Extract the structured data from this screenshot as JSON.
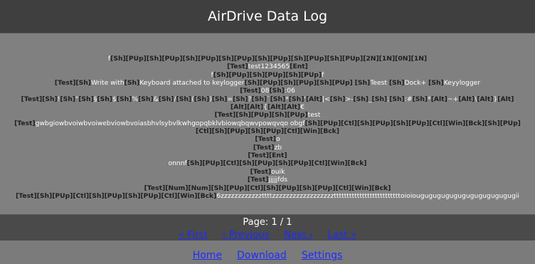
{
  "header": {
    "title": "AirDrive Data Log"
  },
  "log": {
    "lines": [
      [
        [
          "v",
          "f"
        ],
        [
          "k",
          "[Sh][PUp][Sh][PUp][Sh][PUp][Sh][PUp][Sh][PUp][Sh][PUp][Sh][PUp][2N][1N][0N][1N]"
        ]
      ],
      [
        [
          "k",
          "[Test]"
        ],
        [
          "v",
          "test1234565"
        ],
        [
          "k",
          "[Ent]"
        ]
      ],
      [
        [
          "v",
          "f"
        ],
        [
          "k",
          "[Sh][PUp][Sh][PUp][Sh][PUp]"
        ],
        [
          "v",
          "f"
        ]
      ],
      [
        [
          "k",
          "[Test][Sh]"
        ],
        [
          "v",
          "Write with"
        ],
        [
          "k",
          "[Sh]"
        ],
        [
          "v",
          "Keyboard attached to keylogger"
        ],
        [
          "k",
          "[Sh][PUp][Sh][PUp][Sh][PUp]"
        ],
        [
          "v",
          " "
        ],
        [
          "k",
          "[Sh]"
        ],
        [
          "v",
          "Teest "
        ],
        [
          "k",
          "[Sh]"
        ],
        [
          "v",
          "Dock+ "
        ],
        [
          "k",
          "[Sh]"
        ],
        [
          "v",
          "Keyylogger"
        ]
      ],
      [
        [
          "k",
          "[Test]"
        ],
        [
          "v",
          "08"
        ],
        [
          "k",
          "[Sh]"
        ],
        [
          "v",
          ":06"
        ]
      ],
      [
        [
          "k",
          "[Test][Sh]"
        ],
        [
          "v",
          "!"
        ],
        [
          "k",
          "[Sh]"
        ],
        [
          "v",
          "\""
        ],
        [
          "k",
          "[Sh]"
        ],
        [
          "v",
          "§"
        ],
        [
          "k",
          "[Sh]"
        ],
        [
          "v",
          "$"
        ],
        [
          "k",
          "[Sh]"
        ],
        [
          "v",
          "%"
        ],
        [
          "k",
          "[Sh]"
        ],
        [
          "v",
          "&"
        ],
        [
          "k",
          "[Sh]"
        ],
        [
          "v",
          "/"
        ],
        [
          "k",
          "[Sh]"
        ],
        [
          "v",
          "("
        ],
        [
          "k",
          "[Sh]"
        ],
        [
          "v",
          ")"
        ],
        [
          "k",
          "[Sh]"
        ],
        [
          "v",
          "="
        ],
        [
          "k",
          "[Sh]"
        ],
        [
          "v",
          "?"
        ],
        [
          "k",
          "[Sh]"
        ],
        [
          "v",
          "`"
        ],
        [
          "k",
          "[Sh]"
        ],
        [
          "v",
          "*"
        ],
        [
          "k",
          "[Sh]"
        ],
        [
          "v",
          "'"
        ],
        [
          "k",
          "[Alt]"
        ],
        [
          "v",
          "|<"
        ],
        [
          "k",
          "[Sh]"
        ],
        [
          "v",
          ">-"
        ],
        [
          "k",
          "[Sh]"
        ],
        [
          "v",
          "_"
        ],
        [
          "k",
          "[Sh]"
        ],
        [
          "v",
          ";"
        ],
        [
          "k",
          "[Sh]"
        ],
        [
          "v",
          ":#"
        ],
        [
          "k",
          "[Sh]"
        ],
        [
          "v",
          "*"
        ],
        [
          "k",
          "[Alt]"
        ],
        [
          "v",
          "~+"
        ],
        [
          "k",
          "[Alt]"
        ],
        [
          "v",
          "\\"
        ],
        [
          "k",
          "[Alt]"
        ],
        [
          "v",
          "}"
        ],
        [
          "k",
          "[Alt]"
        ]
      ],
      [
        [
          "k",
          "[Alt][Alt]"
        ],
        [
          "v",
          "{"
        ],
        [
          "k",
          "[Alt][Alt]"
        ],
        [
          "v",
          "€"
        ]
      ],
      [
        [
          "k",
          "[Test][Sh][PUp][Sh][PUp]"
        ],
        [
          "v",
          "test"
        ]
      ],
      [
        [
          "k",
          "[Test]"
        ],
        [
          "v",
          "gwbgiowbvoiwbvoiwebviowbvoiasbhvlsybvlkwhgopqbklvbiowqbqwvpowqvqo obgf"
        ],
        [
          "k",
          "[Sh][PUp][Ctl][Sh][PUp][Sh][PUp][Ctl][Win][Bck][Sh][PUp]"
        ]
      ],
      [
        [
          "k",
          "[Ctl][Sh][PUp][Sh][PUp][Ctl][Win][Bck]"
        ]
      ],
      [
        [
          "k",
          "[Test]"
        ],
        [
          "v",
          "o"
        ]
      ],
      [
        [
          "k",
          "[Test]"
        ],
        [
          "v",
          "zb"
        ]
      ],
      [
        [
          "k",
          "[Test][Ent]"
        ]
      ],
      [
        [
          "v",
          "onnnf"
        ],
        [
          "k",
          "[Sh][PUp][Ctl][Sh][PUp][Sh][PUp][Ctl][Win][Bck]"
        ]
      ],
      [
        [
          "k",
          "[Test]"
        ],
        [
          "v",
          "ouik"
        ]
      ],
      [
        [
          "k",
          "[Test]"
        ],
        [
          "v",
          "jjjjjfds"
        ]
      ],
      [
        [
          "k",
          "[Test][Num][Num][Sh][PUp][Ctl][Sh][PUp][Sh][PUp][Ctl][Win][Bck]"
        ]
      ],
      [
        [
          "k",
          "[Test][Sh][PUp][Ctl][Sh][PUp][Sh][PUp][Ctl][Win][Bck]"
        ],
        [
          "v",
          "6zzzzzzzzzzzzttttzzzzzzzzzzzzzzzzzzttttttttttttttttttttttttttoioiougugugugugugugugugugugugii"
        ]
      ]
    ]
  },
  "pager": {
    "info": "Page: 1 / 1",
    "first": "« First",
    "previous": "‹ Previous",
    "next": "Next ›",
    "last": "Last »"
  },
  "footer": {
    "home": "Home",
    "download": "Download",
    "settings": "Settings"
  }
}
